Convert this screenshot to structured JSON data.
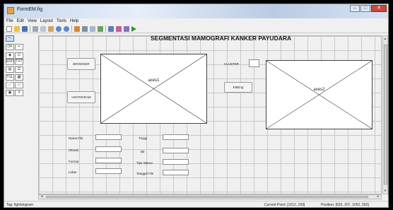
{
  "window": {
    "title": "FormEM.fig",
    "controls": {
      "minimize": "–",
      "maximize": "□",
      "close": "✕"
    }
  },
  "menu": [
    "File",
    "Edit",
    "View",
    "Layout",
    "Tools",
    "Help"
  ],
  "toolbar_icons": [
    "new-file-icon",
    "open-folder-icon",
    "save-icon",
    "cut-icon",
    "copy-icon",
    "paste-icon",
    "undo-icon",
    "redo-icon",
    "align-icon",
    "menu-editor-icon",
    "tab-order-icon",
    "toolbar-editor-icon",
    "mfile-editor-icon",
    "property-inspector-icon",
    "object-browser-icon",
    "run-icon"
  ],
  "palette": [
    {
      "icon": "select-arrow-icon",
      "glyph": "↖"
    },
    {
      "icon": "push-button-icon",
      "glyph": "OK"
    },
    {
      "icon": "slider-icon",
      "glyph": "═"
    },
    {
      "icon": "radio-button-icon",
      "glyph": "◉"
    },
    {
      "icon": "checkbox-icon",
      "glyph": "☑"
    },
    {
      "icon": "edit-text-icon",
      "glyph": "EDIT"
    },
    {
      "icon": "static-text-icon",
      "glyph": "TXT"
    },
    {
      "icon": "popup-menu-icon",
      "glyph": "▤"
    },
    {
      "icon": "listbox-icon",
      "glyph": "☰"
    },
    {
      "icon": "toggle-button-icon",
      "glyph": "TGL"
    },
    {
      "icon": "table-icon",
      "glyph": "▦"
    },
    {
      "icon": "axes-icon",
      "glyph": "📈"
    },
    {
      "icon": "panel-icon",
      "glyph": "▭"
    },
    {
      "icon": "button-group-icon",
      "glyph": "▣"
    },
    {
      "icon": "activex-icon",
      "glyph": "X"
    }
  ],
  "heading": "SEGMENTASI MAMOGRAFI KANKER PAYUDARA",
  "buttons": {
    "browse": "BROWSER",
    "histogram": "HISTOGRAM",
    "editing": "EMEng"
  },
  "cluster_label": "CLUSTER",
  "axes1_label": "axes1",
  "axes2_label": "axes2",
  "fields_left": [
    "Nama File",
    "Ukuran",
    "Format",
    "Lebar"
  ],
  "fields_right": [
    "Tinggi",
    "Bit",
    "Tipe Warna",
    "Tanggal File"
  ],
  "status": {
    "tag": "Tag: fighistogram",
    "current_point": "Current Point: [1012, 159]",
    "position": "Position: [520, 207, 1052, 592]"
  }
}
